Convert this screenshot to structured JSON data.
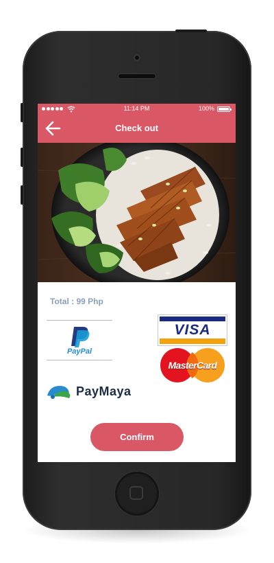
{
  "status_bar": {
    "time": "11:14 PM",
    "battery": "100%"
  },
  "header": {
    "title": "Check out"
  },
  "order": {
    "total": "Total : 99 Php"
  },
  "payment": {
    "paypal": "PayPal",
    "visa": "VISA",
    "mastercard": "MasterCard",
    "paymaya": "PayMaya"
  },
  "confirm_label": "Confirm",
  "colors": {
    "accent": "#da5866",
    "total_text": "#8aa0bb"
  }
}
